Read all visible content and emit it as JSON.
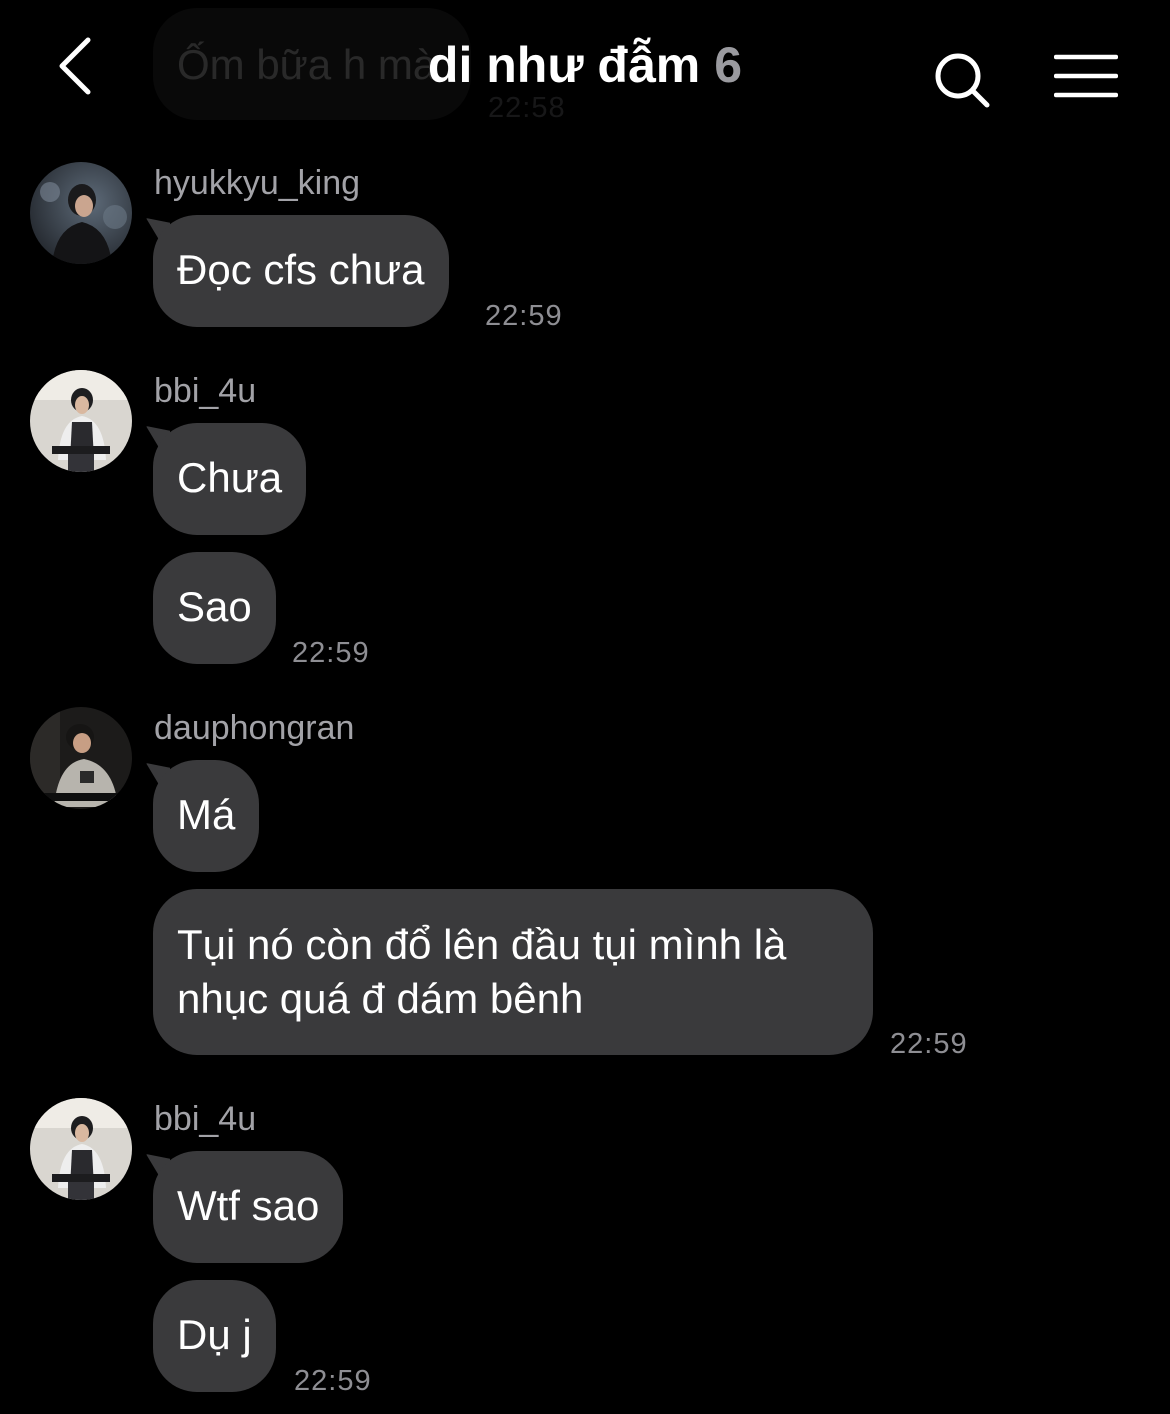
{
  "header": {
    "title": "di như đẫm",
    "member_count": "6",
    "back_icon": "chevron-left-icon",
    "search_icon": "search-icon",
    "menu_icon": "menu-icon"
  },
  "previous": {
    "text": "Ốm bữa h mà",
    "time": "22:58"
  },
  "groups": [
    {
      "sender": "hyukkyu_king",
      "messages": [
        "Đọc cfs chưa"
      ],
      "time": "22:59"
    },
    {
      "sender": "bbi_4u",
      "messages": [
        "Chưa",
        "Sao"
      ],
      "time": "22:59"
    },
    {
      "sender": "dauphongran",
      "messages": [
        "Má",
        "Tụi nó còn đổ lên đầu tụi mình là nhục quá đ dám bênh"
      ],
      "time": "22:59"
    },
    {
      "sender": "bbi_4u",
      "messages": [
        "Wtf sao",
        "Dụ j"
      ],
      "time": "22:59"
    }
  ],
  "colors": {
    "background": "#000000",
    "bubble": "#3a3a3c",
    "timestamp": "#8e8e93",
    "sender": "#a2a2a7"
  }
}
